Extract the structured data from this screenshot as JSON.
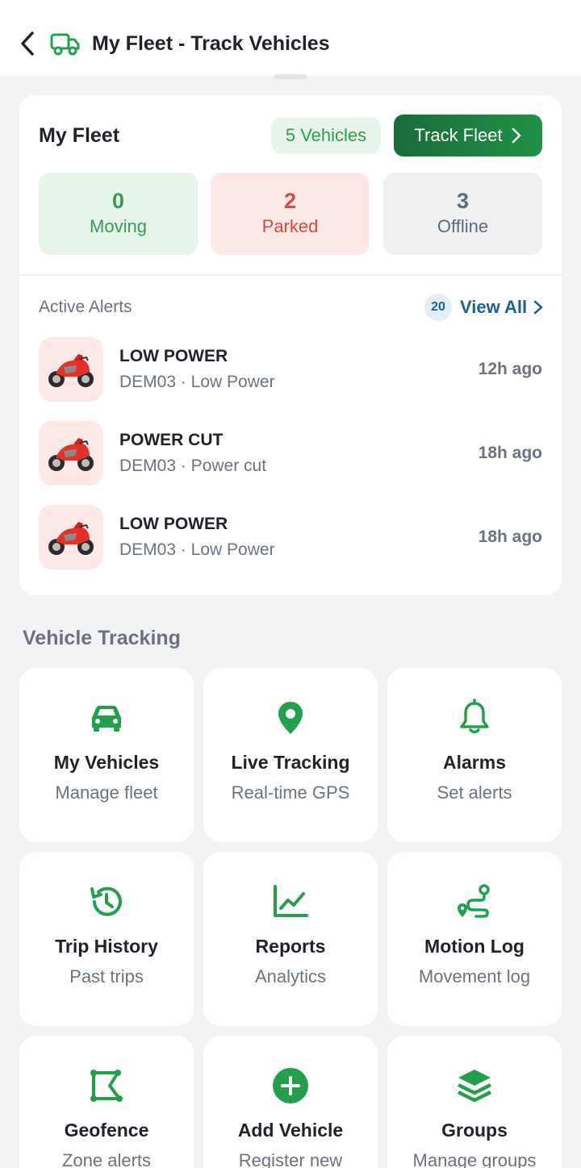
{
  "header": {
    "title": "My Fleet - Track Vehicles",
    "back_icon": "chevron-left-icon",
    "app_icon": "truck-icon"
  },
  "fleet": {
    "title": "My Fleet",
    "vehicles_badge": "5 Vehicles",
    "track_button": "Track Fleet",
    "stats": [
      {
        "value": "0",
        "label": "Moving",
        "color": "#3a9a52"
      },
      {
        "value": "2",
        "label": "Parked",
        "color": "#e0483d"
      },
      {
        "value": "3",
        "label": "Offline",
        "color": "#5d6b78"
      }
    ]
  },
  "alerts": {
    "title": "Active Alerts",
    "count": "20",
    "view_all": "View All",
    "items": [
      {
        "type": "LOW POWER",
        "desc": "DEM03 · Low Power",
        "time": "12h ago",
        "icon": "motorcycle-icon"
      },
      {
        "type": "POWER CUT",
        "desc": "DEM03 · Power cut",
        "time": "18h ago",
        "icon": "motorcycle-icon"
      },
      {
        "type": "LOW POWER",
        "desc": "DEM03 · Low Power",
        "time": "18h ago",
        "icon": "motorcycle-icon"
      }
    ]
  },
  "tracking": {
    "title": "Vehicle Tracking",
    "accent": "#22a04b",
    "tiles": [
      {
        "label": "My Vehicles",
        "sub": "Manage fleet",
        "icon": "car-icon"
      },
      {
        "label": "Live Tracking",
        "sub": "Real-time GPS",
        "icon": "location-pin-icon"
      },
      {
        "label": "Alarms",
        "sub": "Set alerts",
        "icon": "bell-icon"
      },
      {
        "label": "Trip History",
        "sub": "Past trips",
        "icon": "history-icon"
      },
      {
        "label": "Reports",
        "sub": "Analytics",
        "icon": "line-chart-icon"
      },
      {
        "label": "Motion Log",
        "sub": "Movement log",
        "icon": "route-icon"
      },
      {
        "label": "Geofence",
        "sub": "Zone alerts",
        "icon": "polygon-icon"
      },
      {
        "label": "Add Vehicle",
        "sub": "Register new",
        "icon": "plus-circle-icon"
      },
      {
        "label": "Groups",
        "sub": "Manage groups",
        "icon": "layers-icon"
      }
    ]
  }
}
